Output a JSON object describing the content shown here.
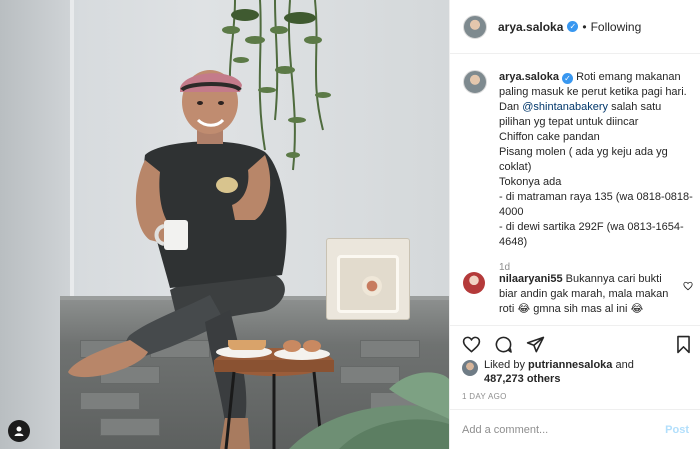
{
  "header": {
    "username": "arya.saloka",
    "separator": "•",
    "follow_status": "Following"
  },
  "caption": {
    "username": "arya.saloka",
    "lines": [
      "Roti emang makanan paling masuk ke perut ketika pagi hari.",
      "salah satu pilihan yg tepat untuk diincar",
      "Chiffon cake pandan",
      "Pisang molen ( ada yg keju ada yg coklat)",
      "Tokonya ada",
      "- di matraman raya 135 (wa 0818-0818-4000",
      "- di dewi sartika 292F (wa 0813-1654-4648)"
    ],
    "prefix_dan": "Dan",
    "mention": "@shintanabakery",
    "time": "1d"
  },
  "comment": {
    "username": "nilaaryani55",
    "text": "Bukannya cari bukti biar andin gak marah, mala makan roti",
    "emoji": "😂",
    "text_after": "gmna sih mas al ini",
    "emoji_end": "😂"
  },
  "likes": {
    "prefix": "Liked by",
    "first_liker": "putriannesaloka",
    "connector": "and",
    "count": "487,273 others"
  },
  "posted": "1 DAY AGO",
  "add_comment": {
    "placeholder": "Add a comment...",
    "post_label": "Post"
  },
  "icons": {
    "like": "heart-icon",
    "comment": "comment-icon",
    "share": "share-icon",
    "save": "bookmark-icon",
    "tagged_user": "user-tag-icon",
    "verified": "verified-badge-icon"
  },
  "colors": {
    "verified_blue": "#3897f0",
    "post_button_disabled": "#b2dffc",
    "secondary_text": "#8e8e8e",
    "mention": "#00376b"
  }
}
